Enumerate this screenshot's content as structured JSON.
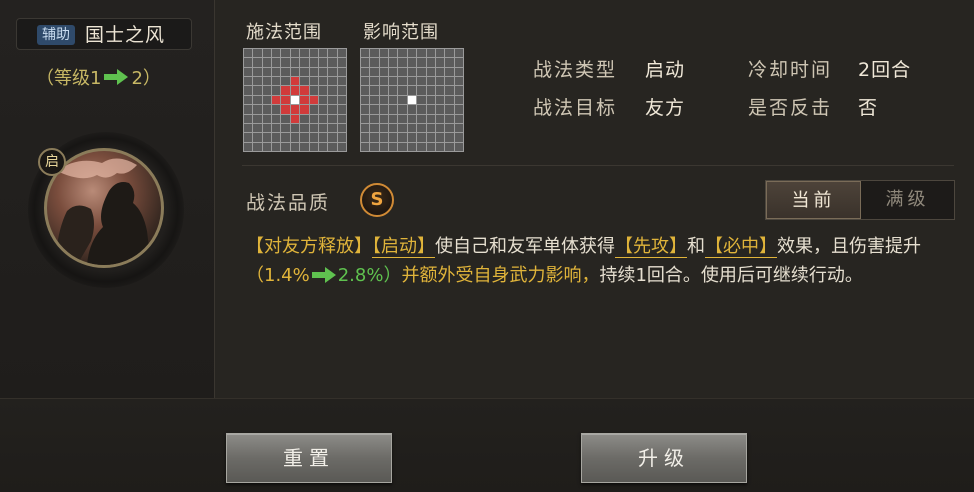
{
  "skill": {
    "tag": "辅助",
    "name": "国士之风",
    "level_open": "（等级1",
    "level_to": "2）",
    "portrait_badge": "启"
  },
  "ranges": {
    "cast_title": "施法范围",
    "effect_title": "影响范围"
  },
  "info": {
    "type_label": "战法类型",
    "type_value": "启动",
    "cooldown_label": "冷却时间",
    "cooldown_value": "2回合",
    "target_label": "战法目标",
    "target_value": "友方",
    "counter_label": "是否反击",
    "counter_value": "否"
  },
  "quality": {
    "label": "战法品质",
    "grade": "S"
  },
  "tabs": {
    "current": "当前",
    "max": "满级"
  },
  "description": {
    "p1": "【对友方释放】",
    "p2": "【启动】",
    "p3": "使自己和友军单体获得",
    "p4": "【先攻】",
    "p5": "和",
    "p6": "【必中】",
    "p7": "效果，且伤害提升",
    "p8": "（1.4%",
    "p9": "2.8%）",
    "p10": "并额外受自身武力影响，",
    "p11": "持续1回合。使用后可继续行动。"
  },
  "buttons": {
    "reset": "重置",
    "upgrade": "升级"
  },
  "colors": {
    "highlight_yellow": "#e0b43a",
    "arrow_green": "#5fc24f",
    "grid_red": "#d13b3b",
    "quality_orange": "#f0a540"
  }
}
